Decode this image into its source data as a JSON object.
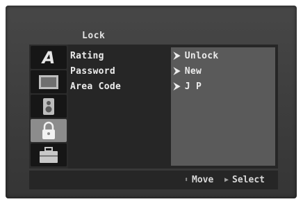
{
  "title": "Lock",
  "sidebar": {
    "items": [
      {
        "icon": "letter-a-icon",
        "label": "A"
      },
      {
        "icon": "tv-screen-icon"
      },
      {
        "icon": "speaker-icon"
      },
      {
        "icon": "padlock-icon"
      },
      {
        "icon": "toolbox-icon"
      }
    ],
    "active_index": 3
  },
  "menu": {
    "items": [
      {
        "label": "Rating",
        "value": "Unlock"
      },
      {
        "label": "Password",
        "value": "New"
      },
      {
        "label": "Area Code",
        "value": "J P"
      }
    ]
  },
  "footer": {
    "move_icon": "up-down-arrows-icon",
    "move_label": "Move",
    "select_icon": "right-triangle-icon",
    "select_label": "Select"
  },
  "colors": {
    "background": "#3c3c3c",
    "panel": "#262626",
    "value_panel": "#5a5a5a",
    "active_tab": "#8c8c8c",
    "text": "#ececec"
  }
}
